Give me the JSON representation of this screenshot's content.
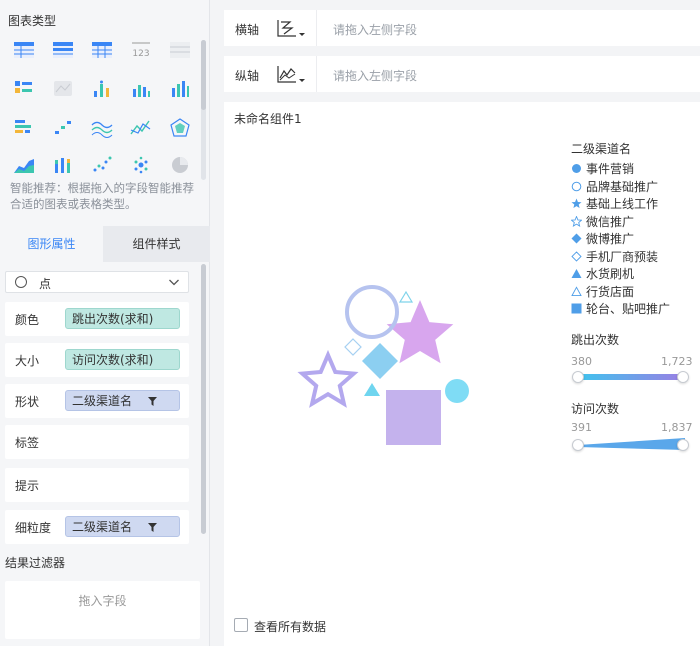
{
  "left_panel": {
    "chart_types_title": "图表类型",
    "chart_type_icons": [
      "table-icon",
      "crosstab-icon",
      "grouped-table-icon",
      "number-card-icon",
      "disabled-table-icon",
      "kpi-icon",
      "disabled-map-icon",
      "stacked-dot-icon",
      "bar-chart-icon",
      "column-chart-icon",
      "horizontal-bar-icon",
      "step-line-icon",
      "multi-line-icon",
      "line-chart-icon",
      "radar-icon",
      "area-chart-icon",
      "stacked-column-icon",
      "scatter-icon",
      "dot-cloud-icon",
      "pie-chart-icon"
    ],
    "recommend_text": "智能推荐：根据拖入的字段智能推荐合适的图表或表格类型。",
    "tabs": [
      "图形属性",
      "组件样式"
    ],
    "shape_select_value": "点",
    "props": [
      {
        "label": "颜色",
        "chip": "跳出次数(求和)",
        "chip_type": "green"
      },
      {
        "label": "大小",
        "chip": "访问次数(求和)",
        "chip_type": "green"
      },
      {
        "label": "形状",
        "chip": "二级渠道名",
        "chip_type": "blue"
      },
      {
        "label": "标签",
        "chip": "",
        "chip_type": ""
      },
      {
        "label": "提示",
        "chip": "",
        "chip_type": ""
      },
      {
        "label": "细粒度",
        "chip": "二级渠道名",
        "chip_type": "blue"
      }
    ],
    "filter_title": "结果过滤器",
    "filter_placeholder": "拖入字段"
  },
  "axes": {
    "x_label": "横轴",
    "y_label": "纵轴",
    "placeholder": "请拖入左侧字段"
  },
  "widget": {
    "title": "未命名组件1",
    "legend_title": "二级渠道名",
    "legend": [
      {
        "name": "事件营销",
        "shape": "circle-filled"
      },
      {
        "name": "品牌基础推广",
        "shape": "circle-outline"
      },
      {
        "name": "基础上线工作",
        "shape": "star-filled"
      },
      {
        "name": "微信推广",
        "shape": "star-outline"
      },
      {
        "name": "微博推广",
        "shape": "diamond-filled"
      },
      {
        "name": "手机厂商预装",
        "shape": "diamond-outline"
      },
      {
        "name": "水货刷机",
        "shape": "triangle-filled"
      },
      {
        "name": "行货店面",
        "shape": "triangle-outline"
      },
      {
        "name": "轮台、贴吧推广",
        "shape": "square-filled"
      }
    ],
    "color_legend": {
      "title": "跳出次数",
      "min": "380",
      "max": "1,723",
      "gradient": [
        "#3fc4ee",
        "#9b7ee4"
      ]
    },
    "size_legend": {
      "title": "访问次数",
      "min": "391",
      "max": "1,837",
      "color": "#5aa7ea"
    },
    "view_all_label": "查看所有数据"
  },
  "colors": {
    "accent": "#3a86f5",
    "legend_marker": "#4f9ee8"
  }
}
